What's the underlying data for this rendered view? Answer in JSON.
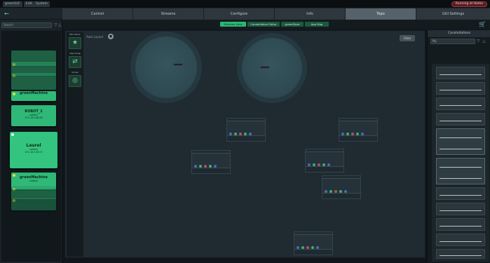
{
  "menubar": {
    "items": [
      "greenGLF",
      "Edit",
      "System"
    ],
    "status": "Running at Home"
  },
  "left_panel": {
    "back_label": "←",
    "search_value": "Search",
    "devices": [
      {
        "name": "",
        "sub": "",
        "faded": true
      },
      {
        "name": "",
        "sub": "",
        "faded": true
      },
      {
        "name": "",
        "sub": "",
        "faded": true
      },
      {
        "name": "greenMachine",
        "sub": "",
        "faded": false
      },
      {
        "name": "ROBOT_1",
        "sub": "calibre",
        "sub2": "172.16.156.60",
        "faded": false
      },
      {
        "name": "Laurel",
        "sub": "calibre",
        "sub2": "172.16.139.07",
        "faded": false,
        "selected": true
      },
      {
        "name": "greenMachine",
        "sub": "calibre",
        "faded": false
      },
      {
        "name": "",
        "sub": "",
        "faded": true
      },
      {
        "name": "",
        "sub": "",
        "faded": true
      }
    ]
  },
  "nav_tabs": [
    "Control",
    "Streams",
    "Configure",
    "Info",
    "Topo",
    "GUI Settings"
  ],
  "nav_active": "Topo",
  "sub_tabs": [
    "Streams View",
    "Constellation Editor",
    "greenStore",
    "App Map"
  ],
  "sub_active": "Streams View",
  "canvas": {
    "tools": [
      {
        "label": "Mini Show",
        "icon": "★"
      },
      {
        "label": "Topo Snap",
        "icon": "⇄"
      },
      {
        "label": "Group",
        "icon": "◎"
      }
    ],
    "auto_layout_label": "Auto Layout",
    "clear_label": "Clear"
  },
  "right_panel": {
    "title": "Constellations",
    "search_value": "My"
  },
  "colors": {
    "accent": "#2bb676",
    "status_red": "#a0353d"
  }
}
